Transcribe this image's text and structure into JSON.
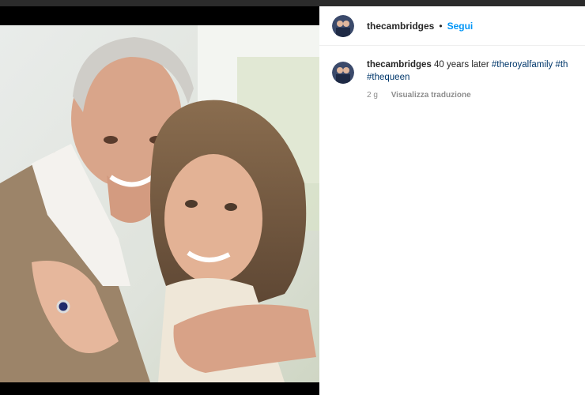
{
  "post": {
    "username": "thecambridges",
    "separator": "•",
    "follow_label": "Segui"
  },
  "caption": {
    "username": "thecambridges",
    "text": "40 years later",
    "hashtags": [
      "#theroyalfamily",
      "#th",
      "#thequeen"
    ],
    "time": "2 g",
    "translate_label": "Visualizza traduzione"
  },
  "colors": {
    "link_blue": "#0095f6",
    "hashtag": "#00376b",
    "meta_gray": "#8e8e8e",
    "text": "#262626"
  },
  "icons": [
    "avatar-icon"
  ]
}
